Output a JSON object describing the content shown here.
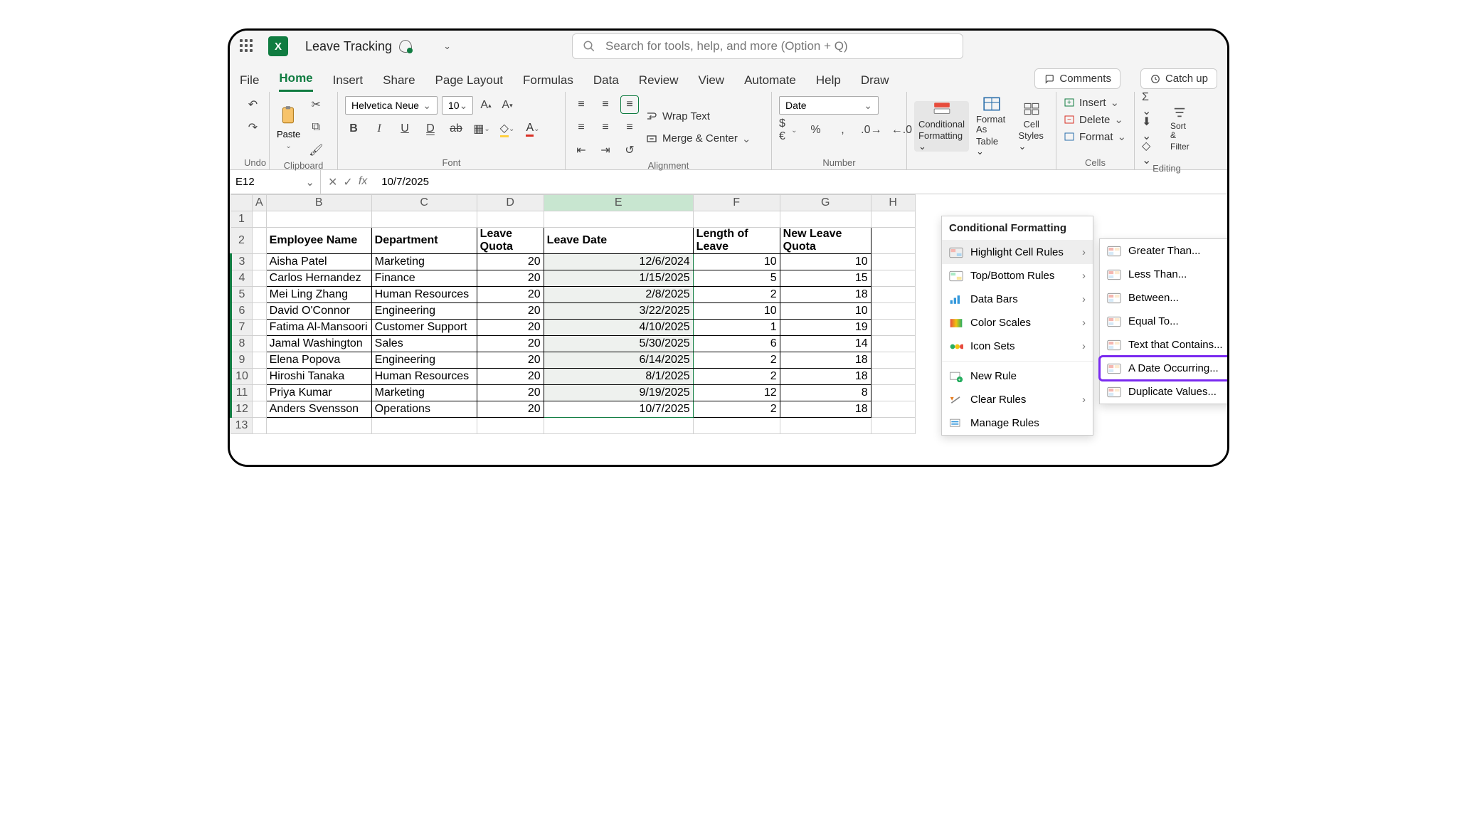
{
  "title": "Leave Tracking",
  "search_placeholder": "Search for tools, help, and more (Option + Q)",
  "tabs": [
    "File",
    "Home",
    "Insert",
    "Share",
    "Page Layout",
    "Formulas",
    "Data",
    "Review",
    "View",
    "Automate",
    "Help",
    "Draw"
  ],
  "active_tab": "Home",
  "pill_comments": "Comments",
  "pill_catchup": "Catch up",
  "ribbon": {
    "undo_label": "Undo",
    "clipboard_label": "Clipboard",
    "paste_label": "Paste",
    "font_label": "Font",
    "font_name": "Helvetica Neue",
    "font_size": "10",
    "alignment_label": "Alignment",
    "wrap_label": "Wrap Text",
    "merge_label": "Merge & Center",
    "number_label": "Number",
    "number_format": "Date",
    "cf_label1": "Conditional",
    "cf_label2": "Formatting",
    "fat_label1": "Format As",
    "fat_label2": "Table",
    "cs_label1": "Cell",
    "cs_label2": "Styles",
    "cells_label": "Cells",
    "insert_label": "Insert",
    "delete_label": "Delete",
    "format_label": "Format",
    "editing_label": "Editing",
    "sort_label1": "Sort &",
    "sort_label2": "Filter"
  },
  "namebox": "E12",
  "formula_value": "10/7/2025",
  "columns": [
    "",
    "A",
    "B",
    "C",
    "D",
    "E",
    "F",
    "G",
    "H"
  ],
  "headers": {
    "B": "Employee Name",
    "C": "Department",
    "D": "Leave Quota",
    "E": "Leave Date",
    "F": "Length of Leave",
    "G": "New Leave Quota"
  },
  "rows": [
    {
      "n": 3,
      "B": "Aisha Patel",
      "C": "Marketing",
      "D": "20",
      "E": "12/6/2024",
      "F": "10",
      "G": "10"
    },
    {
      "n": 4,
      "B": "Carlos Hernandez",
      "C": "Finance",
      "D": "20",
      "E": "1/15/2025",
      "F": "5",
      "G": "15"
    },
    {
      "n": 5,
      "B": "Mei Ling Zhang",
      "C": "Human Resources",
      "D": "20",
      "E": "2/8/2025",
      "F": "2",
      "G": "18"
    },
    {
      "n": 6,
      "B": "David O'Connor",
      "C": "Engineering",
      "D": "20",
      "E": "3/22/2025",
      "F": "10",
      "G": "10"
    },
    {
      "n": 7,
      "B": "Fatima Al-Mansoori",
      "C": "Customer Support",
      "D": "20",
      "E": "4/10/2025",
      "F": "1",
      "G": "19"
    },
    {
      "n": 8,
      "B": "Jamal Washington",
      "C": "Sales",
      "D": "20",
      "E": "5/30/2025",
      "F": "6",
      "G": "14"
    },
    {
      "n": 9,
      "B": "Elena Popova",
      "C": "Engineering",
      "D": "20",
      "E": "6/14/2025",
      "F": "2",
      "G": "18"
    },
    {
      "n": 10,
      "B": "Hiroshi Tanaka",
      "C": "Human Resources",
      "D": "20",
      "E": "8/1/2025",
      "F": "2",
      "G": "18"
    },
    {
      "n": 11,
      "B": "Priya Kumar",
      "C": "Marketing",
      "D": "20",
      "E": "9/19/2025",
      "F": "12",
      "G": "8"
    },
    {
      "n": 12,
      "B": "Anders Svensson",
      "C": "Operations",
      "D": "20",
      "E": "10/7/2025",
      "F": "2",
      "G": "18"
    }
  ],
  "cf_menu": {
    "title": "Conditional Formatting",
    "items": [
      {
        "label": "Highlight Cell Rules",
        "arrow": true,
        "hover": true
      },
      {
        "label": "Top/Bottom Rules",
        "arrow": true
      },
      {
        "label": "Data Bars",
        "arrow": true
      },
      {
        "label": "Color Scales",
        "arrow": true
      },
      {
        "label": "Icon Sets",
        "arrow": true
      },
      {
        "sep": true
      },
      {
        "label": "New Rule"
      },
      {
        "label": "Clear Rules",
        "arrow": true
      },
      {
        "label": "Manage Rules"
      }
    ]
  },
  "sub_menu": [
    {
      "label": "Greater Than..."
    },
    {
      "label": "Less Than..."
    },
    {
      "label": "Between..."
    },
    {
      "label": "Equal To..."
    },
    {
      "label": "Text that Contains..."
    },
    {
      "label": "A Date Occurring...",
      "highlight": true
    },
    {
      "label": "Duplicate Values..."
    }
  ]
}
